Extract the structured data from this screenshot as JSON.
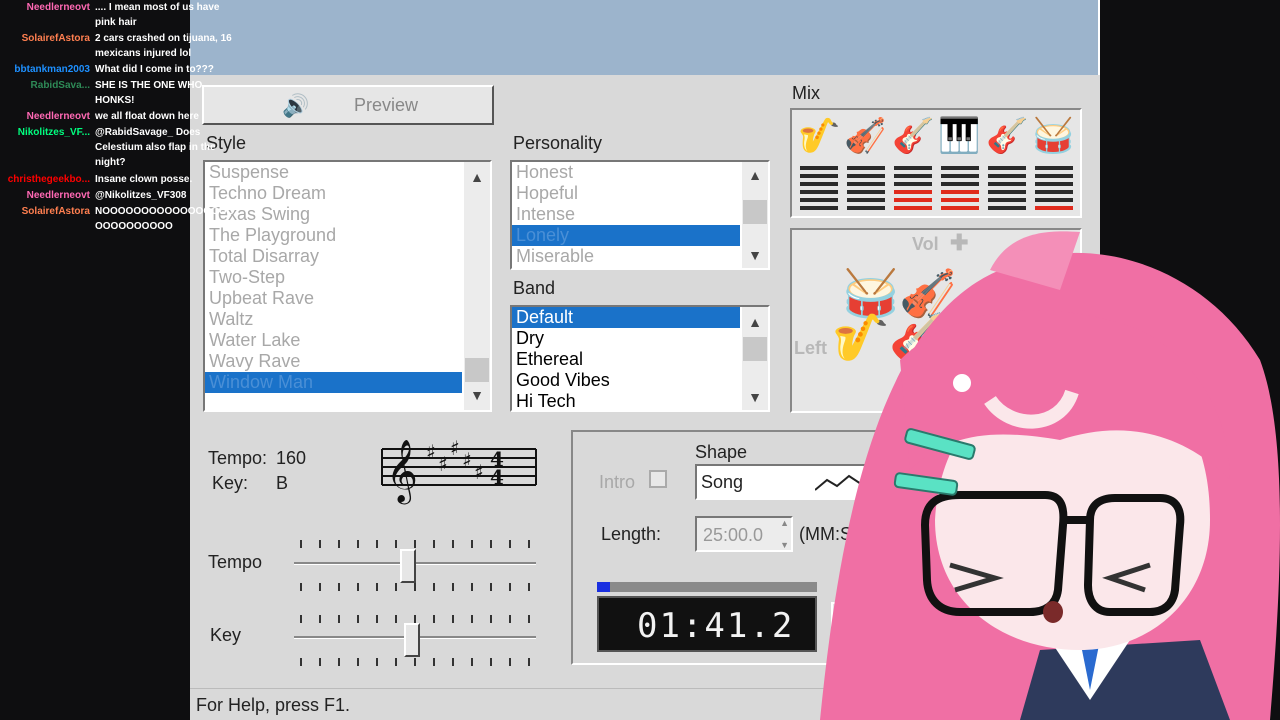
{
  "chat": [
    {
      "name": "Needlerneovt",
      "color": "#ff69b4",
      "lines": [
        ".... I mean most of us have",
        "pink hair"
      ]
    },
    {
      "name": "SolairefAstora",
      "color": "#ff7f50",
      "lines": [
        "2 cars crashed on tijuana, 16",
        "mexicans injured lol"
      ]
    },
    {
      "name": "bbtankman2003",
      "color": "#1e90ff",
      "lines": [
        "What did I come in to???"
      ]
    },
    {
      "name": "RabidSava...",
      "color": "#2e8b57",
      "lines": [
        "SHE IS THE ONE WHO",
        "HONKS!"
      ]
    },
    {
      "name": "Needlerneovt",
      "color": "#ff69b4",
      "lines": [
        "we all float down here"
      ]
    },
    {
      "name": "Nikolitzes_VF...",
      "color": "#00ff7f",
      "lines": [
        "@RabidSavage_ Does",
        "Celestium also flap in the",
        "night?"
      ]
    },
    {
      "name": "christhegeekbo...",
      "color": "#ff0000",
      "lines": [
        "Insane clown posse."
      ]
    },
    {
      "name": "Needlerneovt",
      "color": "#ff69b4",
      "lines": [
        "@Nikolitzes_VF308"
      ]
    },
    {
      "name": "SolairefAstora",
      "color": "#ff7f50",
      "lines": [
        "NOOOOOOOOOOOOOOOOO",
        "OOOOOOOOOO"
      ]
    }
  ],
  "app": {
    "preview_label": "Preview",
    "style_label": "Style",
    "styles": [
      "Suspense",
      "Techno Dream",
      "Texas Swing",
      "The Playground",
      "Total Disarray",
      "Two-Step",
      "Upbeat Rave",
      "Waltz",
      "Water Lake",
      "Wavy Rave",
      "Window Man"
    ],
    "personality_label": "Personality",
    "personalities": [
      "Honest",
      "Hopeful",
      "Intense",
      "Lonely",
      "Miserable"
    ],
    "band_label": "Band",
    "bands": [
      "Default",
      "Dry",
      "Ethereal",
      "Good Vibes",
      "Hi Tech"
    ],
    "mix_label": "Mix",
    "mix_levels": [
      0,
      0,
      3,
      3,
      0,
      1
    ],
    "vol_label": "Vol",
    "left_label": "Left",
    "tempo_text_label": "Tempo:",
    "tempo_value": "160",
    "key_text_label": "Key:",
    "key_value": "B",
    "tempo_slider_label": "Tempo",
    "key_slider_label": "Key",
    "tempo_slider_level": 0.47,
    "key_slider_level": 0.47,
    "intro_label": "Intro",
    "shape_label": "Shape",
    "shape_value": "Song",
    "length_label": "Length:",
    "length_value": "25:00.0",
    "length_unit": "(MM:S",
    "time_display": "01:41.2",
    "progress": 0.06,
    "status_text": "For Help, press F1."
  }
}
